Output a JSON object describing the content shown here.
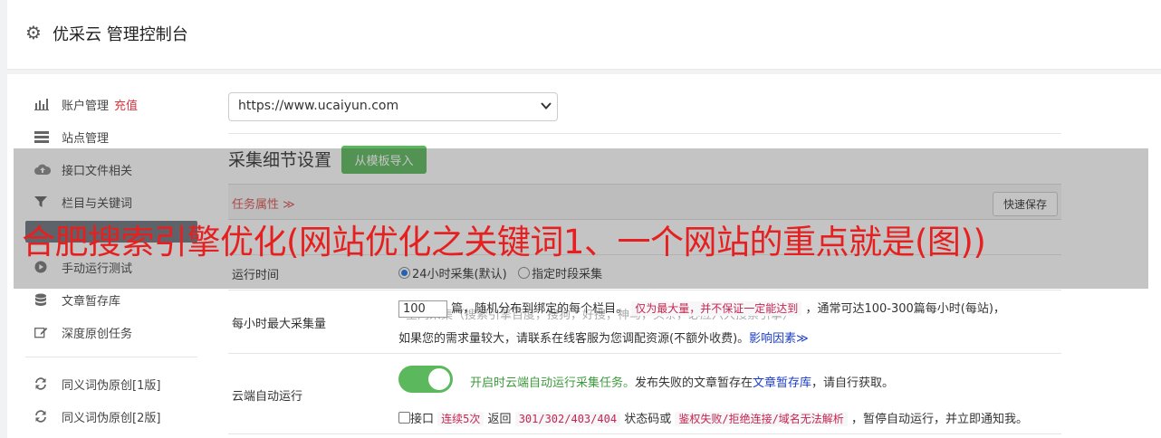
{
  "header": {
    "icon": "gear-icon",
    "title": "优采云 管理控制台"
  },
  "sidebar": {
    "items": [
      {
        "label": "账户管理",
        "extra": "充值",
        "icon": "bar-chart-icon"
      },
      {
        "label": "站点管理",
        "icon": "server-icon"
      },
      {
        "label": "接口文件相关",
        "icon": "cloud-upload-icon"
      },
      {
        "label": "栏目与关键词",
        "icon": "filter-icon"
      },
      {
        "label": "",
        "icon": "active-item-icon"
      },
      {
        "label": "手动运行测试",
        "icon": "play-icon"
      },
      {
        "label": "文章暂存库",
        "icon": "database-icon"
      },
      {
        "label": "深度原创任务",
        "icon": "edit-icon"
      },
      {
        "label": "同义词伪原创[1版]",
        "icon": "refresh-icon"
      },
      {
        "label": "同义词伪原创[2版]",
        "icon": "refresh-icon"
      }
    ]
  },
  "site_select": {
    "value": "https://www.ucaiyun.com"
  },
  "section": {
    "title": "采集细节设置",
    "import_button": "从模板导入"
  },
  "task_props": {
    "label": "任务属性 ≫",
    "save_button": "快速保存"
  },
  "faded_row": {
    "text": "全网采集（搜索引擎百度，搜狗，好搜，神马，头条，必应六大搜索引擎）"
  },
  "run_time": {
    "label": "运行时间",
    "option_all_day": "24小时采集(默认)",
    "option_period": "指定时段采集"
  },
  "max_per_hour": {
    "label": "每小时最大采集量",
    "value": "100",
    "text1": "篇，随机分布到绑定的每个栏目。",
    "note": "仅为最大量，并不保证一定能达到",
    "text2": "，通常可达100-300篇每小时(每站)，",
    "text3": "如果您的需求量较大，请联系在线客服为您调配资源(不额外收费)。",
    "link": "影响因素≫"
  },
  "cloud_run": {
    "label": "云端自动运行",
    "enabled_text": "开启时云端自动运行采集任务。",
    "text_a": "发布失败的文章暂存在",
    "link": "文章暂存库",
    "text_b": "，请自行获取。",
    "chk_prefix": "接口",
    "code1": "连续5次",
    "text_c": "返回",
    "code2": "301/302/403/404",
    "text_d": "状态码或",
    "code3": "鉴权失败/拒绝连接/域名无法解析",
    "text_e": "，暂停自动运行，并立即通知我。"
  },
  "banner": {
    "text": "合肥搜索引擎优化(网站优化之关键词1、一个网站的重点就是(图))"
  },
  "colors": {
    "accent_green": "#5cb85c",
    "banner_red": "#e62020",
    "link_blue": "#1a3bc9"
  }
}
